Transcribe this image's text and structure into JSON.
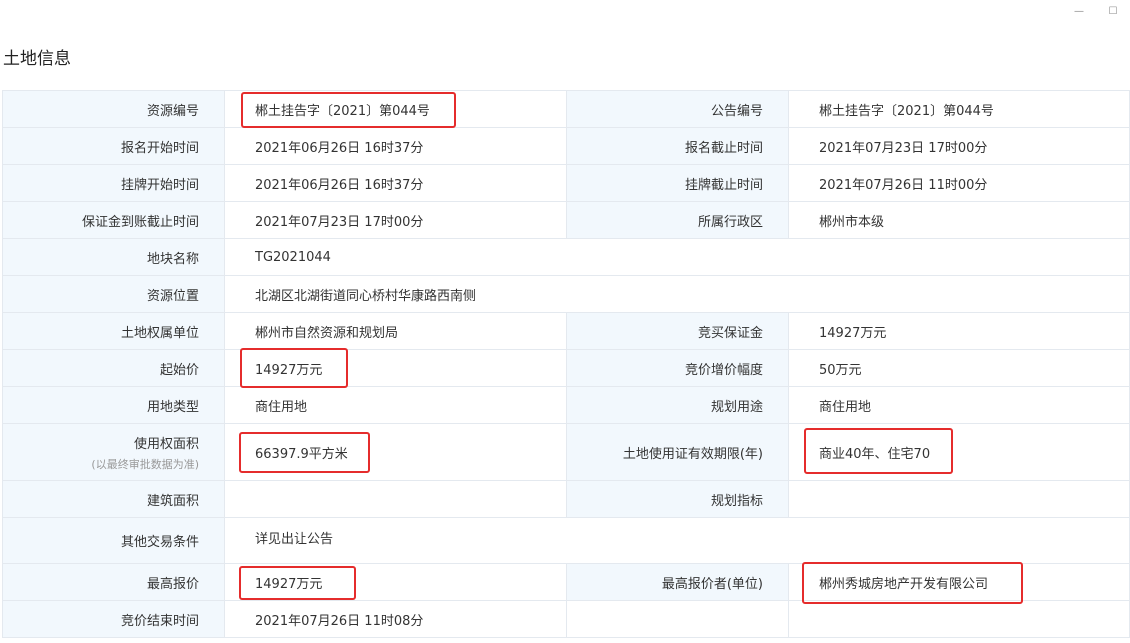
{
  "window": {
    "minimize_icon": "—",
    "maximize_icon": "☐"
  },
  "page_title": "土地信息",
  "fields": {
    "resource_no_label": "资源编号",
    "resource_no": "郴土挂告字〔2021〕第044号",
    "notice_no_label": "公告编号",
    "notice_no": "郴土挂告字〔2021〕第044号",
    "reg_start_label": "报名开始时间",
    "reg_start": "2021年06月26日 16时37分",
    "reg_end_label": "报名截止时间",
    "reg_end": "2021年07月23日 17时00分",
    "listing_start_label": "挂牌开始时间",
    "listing_start": "2021年06月26日 16时37分",
    "listing_end_label": "挂牌截止时间",
    "listing_end": "2021年07月26日 11时00分",
    "deposit_deadline_label": "保证金到账截止时间",
    "deposit_deadline": "2021年07月23日 17时00分",
    "district_label": "所属行政区",
    "district": "郴州市本级",
    "parcel_name_label": "地块名称",
    "parcel_name": "TG2021044",
    "location_label": "资源位置",
    "location": "北湖区北湖街道同心桥村华康路西南侧",
    "owner_label": "土地权属单位",
    "owner": "郴州市自然资源和规划局",
    "bid_deposit_label": "竞买保证金",
    "bid_deposit": "14927万元",
    "start_price_label": "起始价",
    "start_price": "14927万元",
    "increment_label": "竞价增价幅度",
    "increment": "50万元",
    "land_type_label": "用地类型",
    "land_type": "商住用地",
    "planned_use_label": "规划用途",
    "planned_use": "商住用地",
    "area_label": "使用权面积",
    "area_note": "(以最终审批数据为准)",
    "area": "66397.9平方米",
    "term_label": "土地使用证有效期限(年)",
    "term": "商业40年、住宅70",
    "building_area_label": "建筑面积",
    "building_area": "",
    "planning_index_label": "规划指标",
    "planning_index": "",
    "other_terms_label": "其他交易条件",
    "other_terms": "详见出让公告",
    "highest_bid_label": "最高报价",
    "highest_bid": "14927万元",
    "highest_bidder_label": "最高报价者(单位)",
    "highest_bidder": "郴州秀城房地产开发有限公司",
    "end_time_label": "竞价结束时间",
    "end_time": "2021年07月26日 11时08分"
  },
  "highlight_color": "#e52c2c"
}
